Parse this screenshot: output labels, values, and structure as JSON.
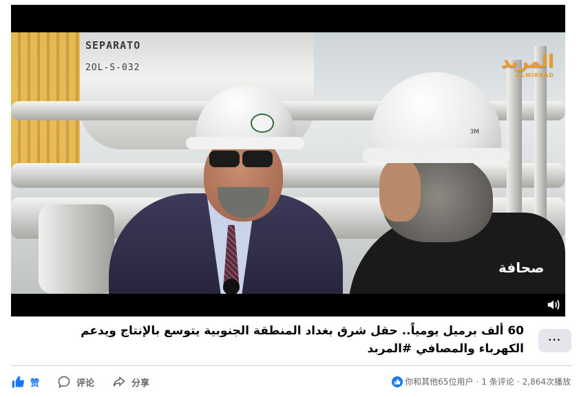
{
  "video": {
    "logo_arabic": "المربد",
    "logo_english": "ALMIRBAD",
    "tank_label_line1": "SEPARATO",
    "tank_label_line2": "2OL-S-032",
    "vest_text": "صحافة",
    "helmet_brand": "3M"
  },
  "post": {
    "title": "60 ألف برميل يومياً.. حقل شرق بغداد المنطقة الجنوبية يتوسع بالإنتاج ويدعم الكهرباء والمصافي #المربد",
    "more_label": "···"
  },
  "actions": {
    "like_label": "赞",
    "comment_label": "评论",
    "share_label": "分享"
  },
  "stats": {
    "reactions_text": "你和其他65位用户",
    "comments_text": "1 条评论",
    "views_text": "2,864次播放",
    "separator": "·"
  },
  "colors": {
    "accent": "#1877f2",
    "muted": "#65676b",
    "logo": "#e89a2c"
  },
  "icons": [
    "like-icon",
    "comment-icon",
    "share-icon",
    "volume-icon",
    "more-icon"
  ]
}
